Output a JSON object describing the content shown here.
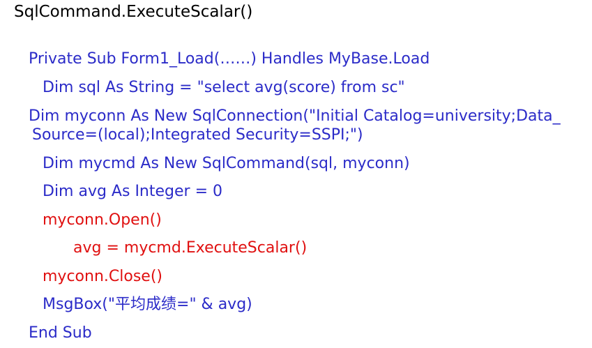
{
  "title": "SqlCommand.ExecuteScalar()",
  "colors": {
    "code": "#2b2bc8",
    "highlight": "#e01010",
    "title": "#000000",
    "background": "#ffffff"
  },
  "code": {
    "line_sub": "Private Sub Form1_Load(……) Handles MyBase.Load",
    "line_sql": "Dim sql As String = \"select avg(score) from sc\"",
    "line_conn_1": "Dim myconn As New SqlConnection(\"Initial Catalog=university;Data_",
    "line_conn_2": "Source=(local);Integrated Security=SSPI;\")",
    "line_cmd": "Dim mycmd As New SqlCommand(sql, myconn)",
    "line_avg": "Dim avg As Integer = 0",
    "line_open": "myconn.Open()",
    "line_exec": "avg = mycmd.ExecuteScalar()",
    "line_close": "myconn.Close()",
    "line_msgbox": "MsgBox(\"平均成绩=\" & avg)",
    "line_end": "End Sub"
  }
}
